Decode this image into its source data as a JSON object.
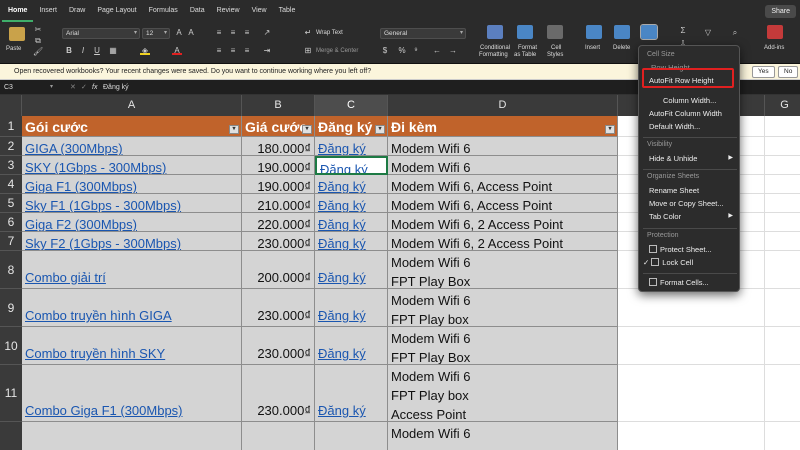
{
  "tabs": [
    "Home",
    "Insert",
    "Draw",
    "Page Layout",
    "Formulas",
    "Data",
    "Review",
    "View",
    "Table"
  ],
  "share_label": "Share",
  "ribbon": {
    "paste": "Paste",
    "font_name": "Arial",
    "font_size": "12",
    "wrap_text": "Wrap Text",
    "merge_center": "Merge & Center",
    "number_format": "General",
    "conditional": [
      "Conditional",
      "Formatting"
    ],
    "format_table": [
      "Format",
      "as Table"
    ],
    "cell_styles": [
      "Cell",
      "Styles"
    ],
    "insert": "Insert",
    "delete": "Delete",
    "addins": "Add-ins"
  },
  "notification": {
    "message": "Open recovered workbooks?  Your recent changes were saved. Do you want to continue working where you left off?",
    "yes": "Yes",
    "no": "No"
  },
  "formula_bar": {
    "name_box": "C3",
    "fx": "fx",
    "value": "Đăng ký"
  },
  "columns": [
    "A",
    "B",
    "C",
    "D",
    "",
    "G"
  ],
  "rows": [
    {
      "num": "1",
      "cells": [
        "Gói cước",
        "Giá cước",
        "Đăng ký",
        "Đi kèm"
      ]
    },
    {
      "num": "2",
      "cells": [
        "GIGA (300Mbps)",
        "180.000₫",
        "Đăng ký",
        "Modem Wifi 6"
      ]
    },
    {
      "num": "3",
      "cells": [
        "SKY (1Gbps - 300Mbps)",
        "190.000₫",
        "Đăng ký",
        "Modem Wifi 6"
      ]
    },
    {
      "num": "4",
      "cells": [
        "Giga F1 (300Mbps)",
        "190.000₫",
        "Đăng ký",
        "Modem Wifi 6, Access Point"
      ]
    },
    {
      "num": "5",
      "cells": [
        "Sky F1 (1Gbps - 300Mbps)",
        "210.000₫",
        "Đăng ký",
        "Modem Wifi 6, Access Point"
      ]
    },
    {
      "num": "6",
      "cells": [
        "Giga F2 (300Mbps)",
        "220.000₫",
        "Đăng ký",
        "Modem Wifi 6, 2 Access Point"
      ]
    },
    {
      "num": "7",
      "cells": [
        "Sky F2 (1Gbps - 300Mbps)",
        "230.000₫",
        "Đăng ký",
        "Modem Wifi 6, 2 Access Point"
      ]
    },
    {
      "num": "8",
      "cells": [
        "Combo giải trí",
        "200.000₫",
        "Đăng ký",
        "Modem Wifi 6\nFPT Play Box"
      ]
    },
    {
      "num": "9",
      "cells": [
        "Combo truyền hình GIGA",
        "230.000₫",
        "Đăng ký",
        "Modem Wifi 6\nFPT Play box"
      ]
    },
    {
      "num": "10",
      "cells": [
        "Combo truyền hình SKY",
        "230.000₫",
        "Đăng ký",
        "Modem Wifi 6\nFPT Play Box"
      ]
    },
    {
      "num": "11",
      "cells": [
        "Combo Giga F1 (300Mbps)",
        "230.000₫",
        "Đăng ký",
        "Modem Wifi 6\nFPT Play box\nAccess Point"
      ]
    },
    {
      "num": "",
      "cells": [
        "",
        "",
        "",
        "Modem Wifi 6"
      ]
    }
  ],
  "menu": {
    "cell_size_header": "Cell Size",
    "row_height": "Row Height...",
    "autofit_row": "AutoFit Row Height",
    "column_width": "Column Width...",
    "autofit_column": "AutoFit Column Width",
    "default_width": "Default Width...",
    "visibility_header": "Visibility",
    "hide_unhide": "Hide & Unhide",
    "organize_header": "Organize Sheets",
    "rename": "Rename Sheet",
    "move_copy": "Move or Copy Sheet...",
    "tab_color": "Tab Color",
    "protection_header": "Protection",
    "protect_sheet": "Protect Sheet...",
    "lock_cell": "Lock Cell",
    "format_cells": "Format Cells..."
  },
  "colors": {
    "header_fill": "#c0632b",
    "link": "#1a56b0",
    "highlight": "#e02020",
    "accent": "#3fae6a"
  }
}
